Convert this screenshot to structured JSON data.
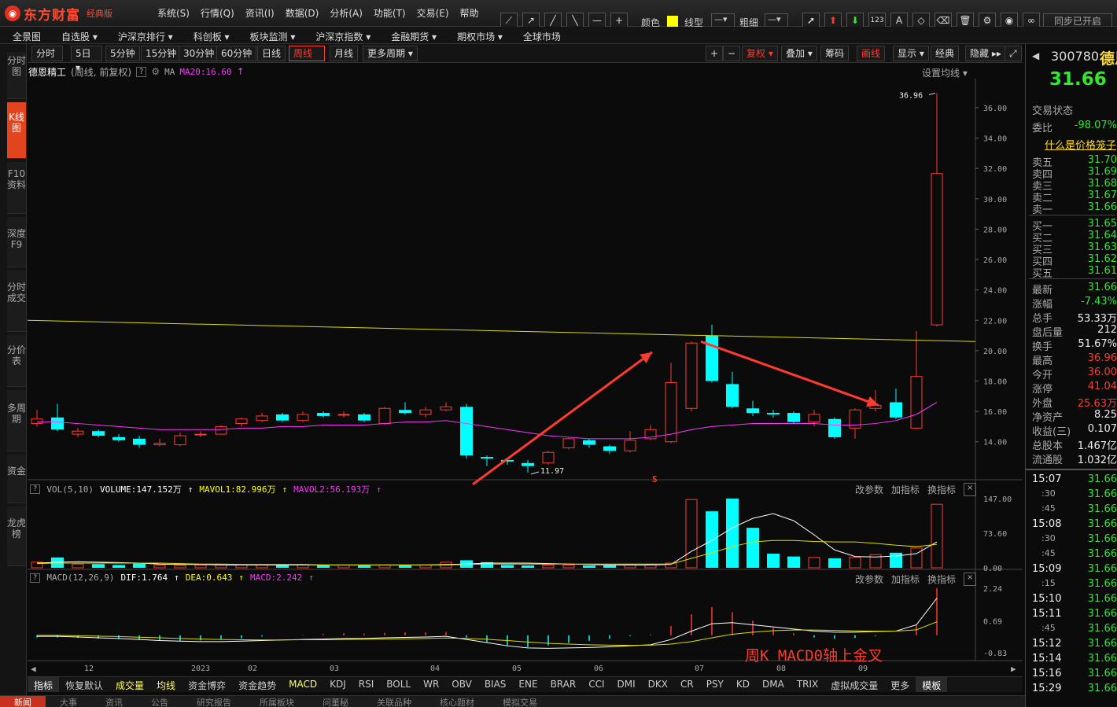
{
  "app": {
    "brand": "东方财富",
    "edition": "经典版"
  },
  "menu": [
    "系统(S)",
    "行情(Q)",
    "资讯(I)",
    "数据(D)",
    "分析(A)",
    "功能(T)",
    "交易(E)",
    "帮助"
  ],
  "drawtools": {
    "color_label": "颜色",
    "linetype_label": "线型",
    "thickness_label": "粗细",
    "sync_label": "同步已开启",
    "color_swatch": "#ffff00"
  },
  "nav2": [
    "全景图",
    "自选股 ▾",
    "沪深京排行 ▾",
    "科创板 ▾",
    "板块监测 ▾",
    "沪深京指数 ▾",
    "金融期货 ▾",
    "期权市场 ▾",
    "全球市场"
  ],
  "sidebar": [
    {
      "label": "分时图"
    },
    {
      "label": "K线图"
    },
    {
      "label": "F10资料"
    },
    {
      "label": "深度F9"
    },
    {
      "label": "分时成交"
    },
    {
      "label": "分价表"
    },
    {
      "label": "多周期"
    },
    {
      "label": "资金"
    },
    {
      "label": "龙虎榜"
    }
  ],
  "periods": [
    "分时",
    "5日 ▾",
    "5分钟",
    "15分钟",
    "30分钟",
    "60分钟",
    "日线",
    "周线",
    "月线",
    "更多周期 ▾"
  ],
  "period_active": "周线",
  "chart_tools": [
    "+",
    "−",
    "复权 ▾",
    "叠加 ▾",
    "筹码",
    "画线",
    "显示 ▾",
    "经典",
    "隐藏 ▸▸"
  ],
  "chart_header": {
    "stock_name": "德恩精工",
    "mode": "(周线, 前复权)",
    "ma_label": "MA",
    "ma20": "MA20:16.60",
    "right_label": "设置均线 ▾"
  },
  "price_axis": [
    "36.00",
    "34.00",
    "32.00",
    "30.00",
    "28.00",
    "26.00",
    "24.00",
    "22.00",
    "20.00",
    "18.00",
    "16.00",
    "14.00"
  ],
  "annotations": {
    "high": "36.96",
    "low": "11.97",
    "signal": "S",
    "macd_text": "周K MACD0轴上金叉"
  },
  "volume_header": {
    "title": "VOL(5,10)",
    "volume": "VOLUME:147.152万",
    "mavol1": "MAVOL1:82.996万",
    "mavol2": "MAVOL2:56.193万"
  },
  "volume_axis": [
    "147.00",
    "73.60",
    "0.00"
  ],
  "macd_header": {
    "title": "MACD(12,26,9)",
    "dif": "DIF:1.764",
    "dea": "DEA:0.643",
    "macd": "MACD:2.242"
  },
  "macd_axis": [
    "2.24",
    "0.69",
    "-0.83"
  ],
  "panel_links": {
    "params": "改参数",
    "add": "加指标",
    "swap": "换指标"
  },
  "x_axis": [
    "12",
    "2023",
    "02",
    "03",
    "04",
    "05",
    "06",
    "07",
    "08",
    "09"
  ],
  "indicators": [
    "指标",
    "恢复默认",
    "成交量",
    "均线",
    "资金博弈",
    "资金趋势",
    "MACD",
    "KDJ",
    "RSI",
    "BOLL",
    "WR",
    "OBV",
    "BIAS",
    "ENE",
    "BRAR",
    "CCI",
    "DMI",
    "DKX",
    "CR",
    "PSY",
    "KD",
    "DMA",
    "TRIX",
    "虚拟成交量",
    "更多",
    "模板"
  ],
  "bottom_tabs": [
    "新闻",
    "大事",
    "资讯",
    "公告",
    "研究报告",
    "所属板块",
    "问董秘",
    "关联品种",
    "核心题材",
    "模拟交易"
  ],
  "right": {
    "code": "300780",
    "name": "德恩",
    "price": "31.66",
    "status_label": "交易状态",
    "weibi_label": "委比",
    "weibi": "-98.07%",
    "link": "什么是价格笼子",
    "asks": [
      {
        "l": "卖五",
        "v": "31.70"
      },
      {
        "l": "卖四",
        "v": "31.69"
      },
      {
        "l": "卖三",
        "v": "31.68"
      },
      {
        "l": "卖二",
        "v": "31.67"
      },
      {
        "l": "卖一",
        "v": "31.66"
      }
    ],
    "bids": [
      {
        "l": "买一",
        "v": "31.65"
      },
      {
        "l": "买二",
        "v": "31.64"
      },
      {
        "l": "买三",
        "v": "31.63"
      },
      {
        "l": "买四",
        "v": "31.62"
      },
      {
        "l": "买五",
        "v": "31.61"
      }
    ],
    "stats": [
      {
        "l": "最新",
        "v": "31.66"
      },
      {
        "l": "涨幅",
        "v": "-7.43%"
      },
      {
        "l": "总手",
        "v": "53.33万"
      },
      {
        "l": "盘后量",
        "v": "212"
      },
      {
        "l": "换手",
        "v": "51.67%"
      },
      {
        "l": "最高",
        "v": "36.96"
      },
      {
        "l": "今开",
        "v": "36.00"
      },
      {
        "l": "涨停",
        "v": "41.04"
      },
      {
        "l": "外盘",
        "v": "25.63万"
      },
      {
        "l": "净资产",
        "v": "8.25"
      },
      {
        "l": "收益(三)",
        "v": "0.107"
      },
      {
        "l": "总股本",
        "v": "1.467亿"
      },
      {
        "l": "流通股",
        "v": "1.032亿"
      }
    ],
    "ticks": [
      {
        "t": "15:07",
        "v": "31.66"
      },
      {
        "t": ":30",
        "v": "31.66"
      },
      {
        "t": ":45",
        "v": "31.66"
      },
      {
        "t": "15:08",
        "v": "31.66"
      },
      {
        "t": ":30",
        "v": "31.66"
      },
      {
        "t": ":45",
        "v": "31.66"
      },
      {
        "t": "15:09",
        "v": "31.66"
      },
      {
        "t": ":15",
        "v": "31.66"
      },
      {
        "t": "15:10",
        "v": "31.66"
      },
      {
        "t": "15:11",
        "v": "31.66"
      },
      {
        "t": ":45",
        "v": "31.66"
      },
      {
        "t": "15:12",
        "v": "31.66"
      },
      {
        "t": "15:14",
        "v": "31.66"
      },
      {
        "t": "15:16",
        "v": "31.66"
      },
      {
        "t": "15:29",
        "v": "31.66"
      }
    ]
  },
  "chart_data": {
    "type": "candlestick",
    "ylim": [
      11.5,
      37.5
    ],
    "candles": [
      {
        "o": 15.2,
        "c": 15.5,
        "h": 16.1,
        "l": 15.0
      },
      {
        "o": 15.6,
        "c": 14.8,
        "h": 16.5,
        "l": 14.7
      },
      {
        "o": 14.5,
        "c": 14.7,
        "h": 14.9,
        "l": 14.3
      },
      {
        "o": 14.7,
        "c": 14.4,
        "h": 14.8,
        "l": 14.3
      },
      {
        "o": 14.3,
        "c": 14.1,
        "h": 14.5,
        "l": 14.0
      },
      {
        "o": 14.2,
        "c": 13.8,
        "h": 14.4,
        "l": 13.6
      },
      {
        "o": 13.8,
        "c": 13.9,
        "h": 14.2,
        "l": 13.7
      },
      {
        "o": 13.8,
        "c": 14.4,
        "h": 14.6,
        "l": 13.7
      },
      {
        "o": 14.5,
        "c": 14.5,
        "h": 14.7,
        "l": 14.3
      },
      {
        "o": 14.5,
        "c": 15.0,
        "h": 15.1,
        "l": 14.5
      },
      {
        "o": 15.2,
        "c": 15.5,
        "h": 15.6,
        "l": 15.0
      },
      {
        "o": 15.4,
        "c": 15.7,
        "h": 15.9,
        "l": 15.3
      },
      {
        "o": 15.8,
        "c": 15.4,
        "h": 15.9,
        "l": 15.3
      },
      {
        "o": 15.4,
        "c": 15.8,
        "h": 16.0,
        "l": 15.3
      },
      {
        "o": 15.9,
        "c": 15.7,
        "h": 16.0,
        "l": 15.6
      },
      {
        "o": 15.8,
        "c": 15.8,
        "h": 16.0,
        "l": 15.6
      },
      {
        "o": 15.8,
        "c": 15.4,
        "h": 15.9,
        "l": 15.3
      },
      {
        "o": 15.2,
        "c": 16.2,
        "h": 16.3,
        "l": 15.1
      },
      {
        "o": 16.1,
        "c": 15.9,
        "h": 16.6,
        "l": 15.8
      },
      {
        "o": 15.8,
        "c": 16.1,
        "h": 16.3,
        "l": 15.6
      },
      {
        "o": 16.1,
        "c": 16.3,
        "h": 16.6,
        "l": 16.0
      },
      {
        "o": 16.3,
        "c": 13.1,
        "h": 16.5,
        "l": 12.9
      },
      {
        "o": 13.0,
        "c": 12.9,
        "h": 13.1,
        "l": 12.4
      },
      {
        "o": 12.8,
        "c": 12.7,
        "h": 12.9,
        "l": 12.5
      },
      {
        "o": 12.6,
        "c": 12.4,
        "h": 12.8,
        "l": 11.97
      },
      {
        "o": 12.6,
        "c": 13.3,
        "h": 13.4,
        "l": 12.5
      },
      {
        "o": 13.6,
        "c": 14.2,
        "h": 14.3,
        "l": 13.5
      },
      {
        "o": 14.1,
        "c": 13.8,
        "h": 14.2,
        "l": 13.6
      },
      {
        "o": 13.7,
        "c": 13.4,
        "h": 13.8,
        "l": 13.2
      },
      {
        "o": 13.4,
        "c": 14.1,
        "h": 14.7,
        "l": 13.3
      },
      {
        "o": 14.2,
        "c": 14.8,
        "h": 15.1,
        "l": 14.1
      },
      {
        "o": 14.0,
        "c": 17.9,
        "h": 19.2,
        "l": 13.9
      },
      {
        "o": 16.2,
        "c": 20.5,
        "h": 20.6,
        "l": 16.0
      },
      {
        "o": 21.0,
        "c": 18.0,
        "h": 21.7,
        "l": 17.9
      },
      {
        "o": 17.8,
        "c": 16.3,
        "h": 18.6,
        "l": 16.2
      },
      {
        "o": 16.2,
        "c": 15.9,
        "h": 16.7,
        "l": 15.7
      },
      {
        "o": 15.9,
        "c": 15.8,
        "h": 16.1,
        "l": 15.6
      },
      {
        "o": 15.9,
        "c": 15.3,
        "h": 16.0,
        "l": 15.2
      },
      {
        "o": 15.3,
        "c": 15.8,
        "h": 16.1,
        "l": 15.0
      },
      {
        "o": 15.5,
        "c": 14.3,
        "h": 15.6,
        "l": 14.2
      },
      {
        "o": 14.9,
        "c": 16.1,
        "h": 16.2,
        "l": 14.2
      },
      {
        "o": 16.2,
        "c": 16.4,
        "h": 17.4,
        "l": 16.0
      },
      {
        "o": 16.6,
        "c": 15.6,
        "h": 17.5,
        "l": 15.5
      },
      {
        "o": 14.9,
        "c": 18.3,
        "h": 21.3,
        "l": 14.8
      },
      {
        "o": 21.7,
        "c": 31.66,
        "h": 36.96,
        "l": 21.6
      }
    ],
    "ma20": [
      15.3,
      15.3,
      15.2,
      15.1,
      15.0,
      14.9,
      14.8,
      14.8,
      14.8,
      14.8,
      14.9,
      14.9,
      15.0,
      15.0,
      15.1,
      15.1,
      15.1,
      15.2,
      15.3,
      15.3,
      15.4,
      15.2,
      15.0,
      14.8,
      14.6,
      14.4,
      14.3,
      14.2,
      14.2,
      14.2,
      14.3,
      14.5,
      14.8,
      15.0,
      15.1,
      15.2,
      15.2,
      15.2,
      15.2,
      15.1,
      15.1,
      15.2,
      15.4,
      15.8,
      16.6
    ],
    "volume": {
      "ylim": [
        0,
        147
      ],
      "values": [
        12,
        22,
        8,
        8,
        6,
        9,
        6,
        5,
        6,
        6,
        7,
        6,
        6,
        7,
        6,
        6,
        5,
        6,
        5,
        6,
        12,
        16,
        12,
        6,
        5,
        6,
        6,
        5,
        5,
        6,
        7,
        10,
        145,
        120,
        147,
        85,
        30,
        24,
        22,
        20,
        22,
        28,
        32,
        42,
        135,
        147
      ],
      "mavol1": [
        10,
        12,
        13,
        12,
        11,
        10,
        8,
        7,
        7,
        6,
        6,
        6,
        6,
        6,
        6,
        6,
        6,
        6,
        6,
        6,
        7,
        8,
        10,
        10,
        10,
        9,
        8,
        7,
        6,
        6,
        6,
        7,
        35,
        58,
        85,
        105,
        115,
        100,
        70,
        38,
        24,
        23,
        25,
        30,
        55,
        83
      ],
      "mavol2": [
        9,
        10,
        10,
        10,
        10,
        10,
        10,
        9,
        8,
        8,
        7,
        7,
        7,
        7,
        6,
        6,
        6,
        6,
        6,
        6,
        6,
        7,
        8,
        8,
        8,
        8,
        8,
        8,
        8,
        8,
        8,
        8,
        20,
        32,
        45,
        55,
        58,
        58,
        56,
        55,
        55,
        52,
        48,
        45,
        50,
        56
      ]
    },
    "macd": {
      "ylim": [
        -0.83,
        2.24
      ],
      "dif": [
        -0.05,
        -0.05,
        -0.08,
        -0.12,
        -0.15,
        -0.2,
        -0.25,
        -0.28,
        -0.3,
        -0.3,
        -0.28,
        -0.25,
        -0.22,
        -0.2,
        -0.18,
        -0.15,
        -0.15,
        -0.12,
        -0.1,
        -0.08,
        -0.05,
        -0.2,
        -0.35,
        -0.5,
        -0.6,
        -0.62,
        -0.6,
        -0.58,
        -0.55,
        -0.5,
        -0.45,
        -0.2,
        0.2,
        0.55,
        0.6,
        0.5,
        0.4,
        0.3,
        0.2,
        0.15,
        0.15,
        0.18,
        0.2,
        0.5,
        1.764
      ],
      "dea": [
        0.0,
        0.0,
        -0.02,
        -0.04,
        -0.06,
        -0.09,
        -0.12,
        -0.15,
        -0.18,
        -0.2,
        -0.21,
        -0.22,
        -0.22,
        -0.21,
        -0.21,
        -0.2,
        -0.19,
        -0.18,
        -0.17,
        -0.15,
        -0.13,
        -0.15,
        -0.19,
        -0.25,
        -0.32,
        -0.38,
        -0.42,
        -0.45,
        -0.47,
        -0.48,
        -0.47,
        -0.42,
        -0.3,
        -0.12,
        0.05,
        0.15,
        0.22,
        0.25,
        0.25,
        0.23,
        0.21,
        0.2,
        0.2,
        0.26,
        0.643
      ]
    }
  }
}
